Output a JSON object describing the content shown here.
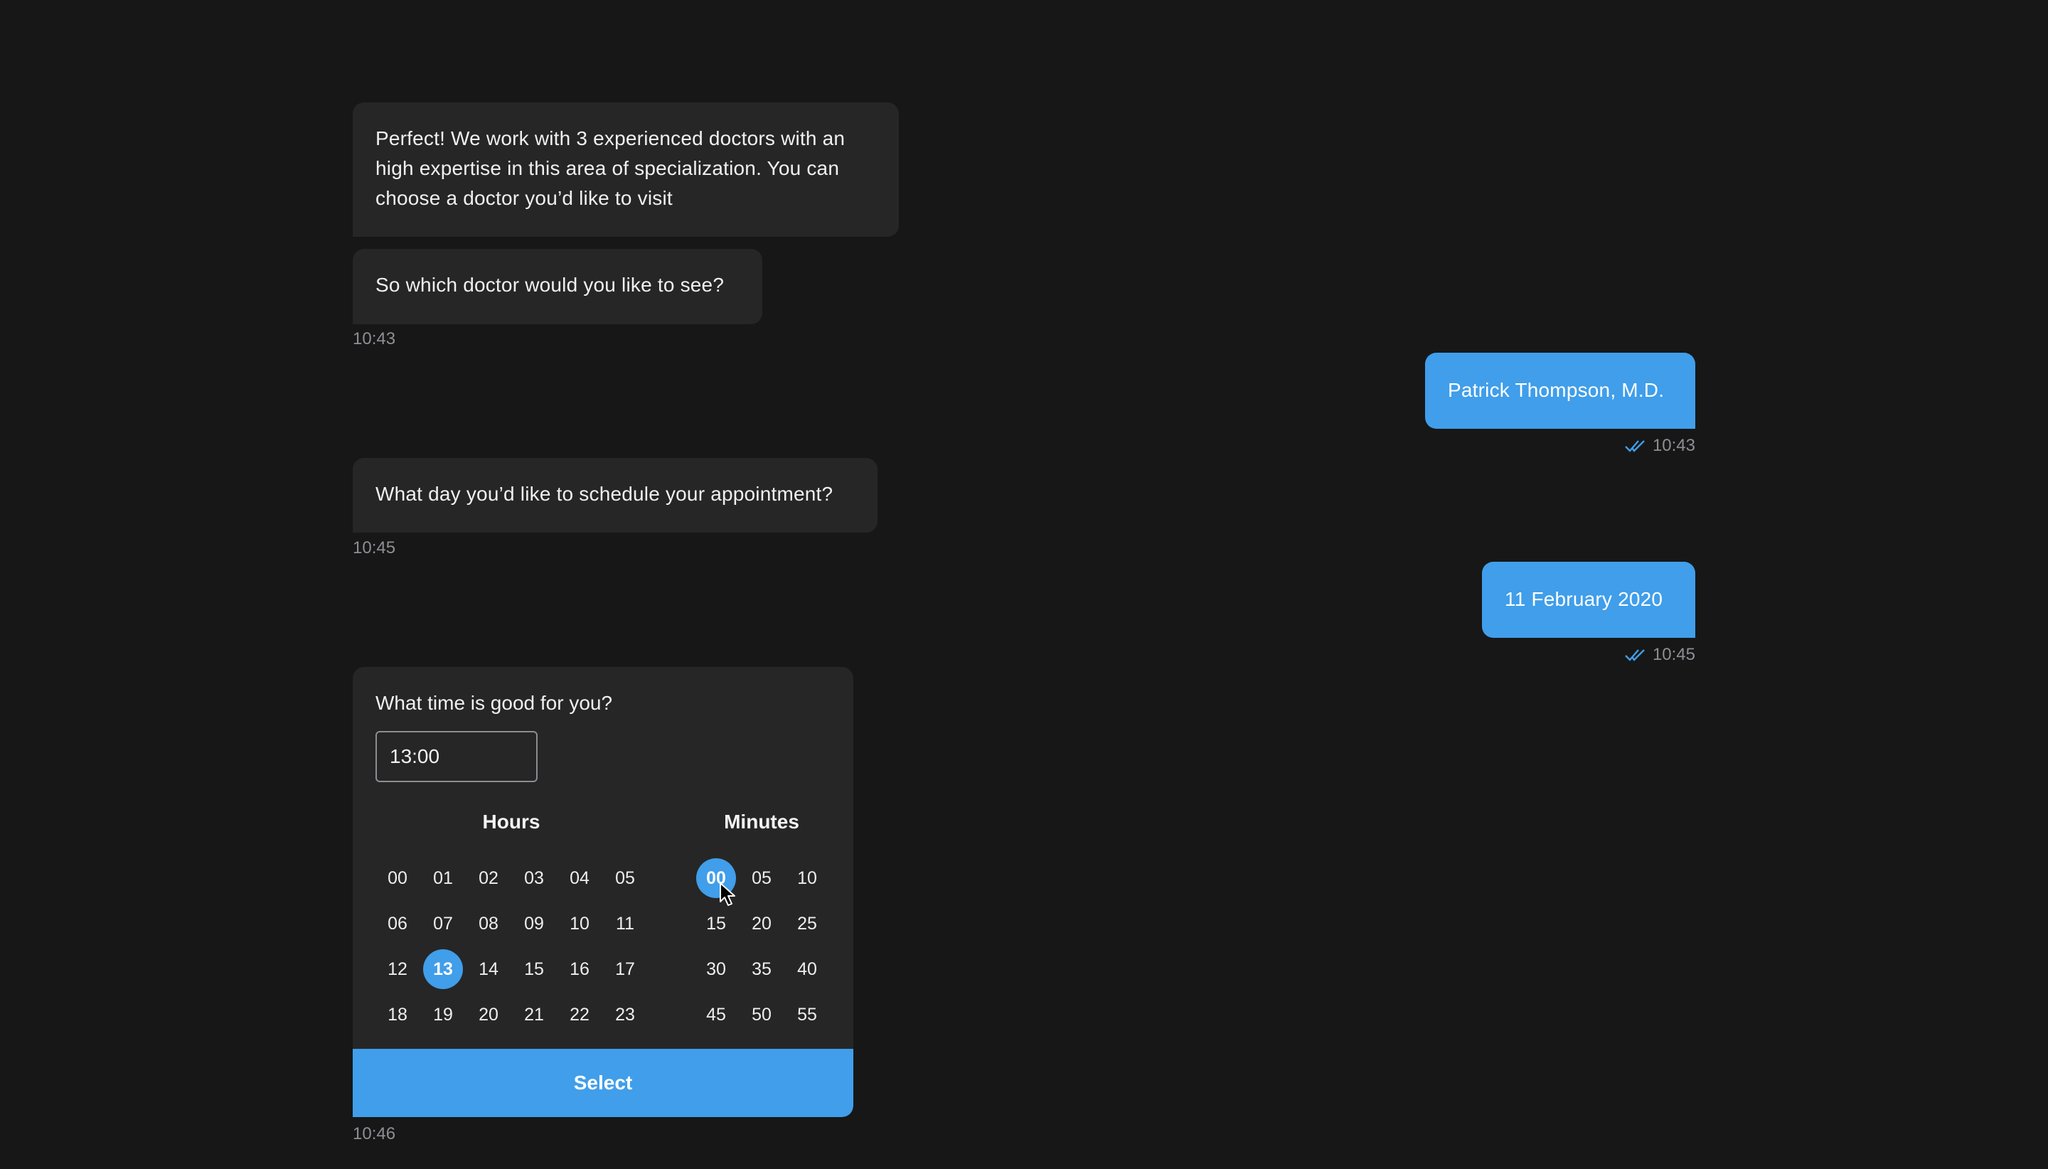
{
  "messages": [
    {
      "id": "m1",
      "direction": "received",
      "text": "Perfect! We work with 3 experienced doctors with an high expertise in this area of specialization. You can choose a doctor you’d like to visit"
    },
    {
      "id": "m2",
      "direction": "received",
      "text": "So which doctor would you like to see?",
      "time": "10:43"
    },
    {
      "id": "m3",
      "direction": "sent",
      "text": "Patrick Thompson, M.D.",
      "time": "10:43",
      "status": "read"
    },
    {
      "id": "m4",
      "direction": "received",
      "text": "What day you’d like to schedule your appointment?",
      "time": "10:45"
    },
    {
      "id": "m5",
      "direction": "sent",
      "text": "11 February 2020",
      "time": "10:45",
      "status": "read"
    }
  ],
  "time_picker": {
    "question": "What time is good for you?",
    "input_value": "13:00",
    "hours_label": "Hours",
    "minutes_label": "Minutes",
    "hours": [
      "00",
      "01",
      "02",
      "03",
      "04",
      "05",
      "06",
      "07",
      "08",
      "09",
      "10",
      "11",
      "12",
      "13",
      "14",
      "15",
      "16",
      "17",
      "18",
      "19",
      "20",
      "21",
      "22",
      "23"
    ],
    "minutes": [
      "00",
      "05",
      "10",
      "15",
      "20",
      "25",
      "30",
      "35",
      "40",
      "45",
      "50",
      "55"
    ],
    "selected_hour": "13",
    "selected_minute": "00",
    "select_label": "Select",
    "time": "10:46"
  },
  "colors": {
    "background": "#171717",
    "bubble_received": "#262626",
    "accent": "#409eea",
    "timestamp": "#8d8f94"
  }
}
